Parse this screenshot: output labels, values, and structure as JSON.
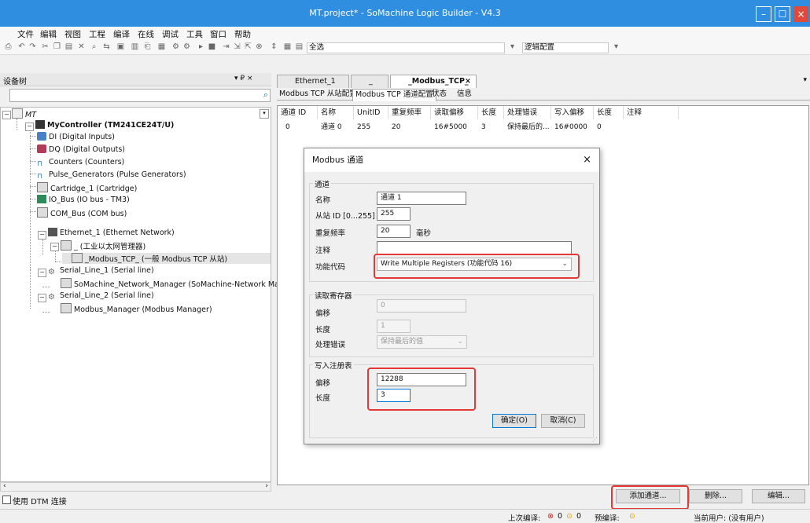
{
  "window": {
    "title": "MT.project* - SoMachine Logic Builder - V4.3"
  },
  "menu": [
    "文件",
    "编辑",
    "视图",
    "工程",
    "编译",
    "在线",
    "调试",
    "工具",
    "窗口",
    "帮助"
  ],
  "toolbar": {
    "select_all": "全选",
    "config_combo": "逻辑配置"
  },
  "device_tree": {
    "title": "设备树",
    "header_icons": "▾ ₽ ×",
    "nodes": [
      {
        "label": "MT",
        "level": 0
      },
      {
        "label": "MyController (TM241CE24T/U)",
        "level": 1
      },
      {
        "label": "DI (Digital Inputs)",
        "level": 2
      },
      {
        "label": "DQ (Digital Outputs)",
        "level": 2
      },
      {
        "label": "Counters (Counters)",
        "level": 2
      },
      {
        "label": "Pulse_Generators (Pulse Generators)",
        "level": 2
      },
      {
        "label": "Cartridge_1 (Cartridge)",
        "level": 2
      },
      {
        "label": "IO_Bus (IO bus - TM3)",
        "level": 2
      },
      {
        "label": "COM_Bus (COM bus)",
        "level": 2
      },
      {
        "label": "Ethernet_1 (Ethernet Network)",
        "level": 2
      },
      {
        "label": "_ (工业以太网管理器)",
        "level": 3
      },
      {
        "label": "_Modbus_TCP_ (一般 Modbus TCP 从站)",
        "level": 4
      },
      {
        "label": "Serial_Line_1 (Serial line)",
        "level": 2
      },
      {
        "label": "SoMachine_Network_Manager (SoMachine-Network Manager)",
        "level": 3
      },
      {
        "label": "Serial_Line_2 (Serial line)",
        "level": 2
      },
      {
        "label": "Modbus_Manager (Modbus Manager)",
        "level": 3
      }
    ],
    "dtm_checkbox": "使用 DTM 连接"
  },
  "doc_tabs": [
    "Ethernet_1",
    "_",
    "_Modbus_TCP_"
  ],
  "sub_tabs": [
    "Modbus TCP 从站配置",
    "Modbus TCP 通道配置",
    "状态",
    "信息"
  ],
  "channel_grid": {
    "headers": [
      "通道 ID",
      "名称",
      "UnitID",
      "重复频率",
      "读取偏移",
      "长度",
      "处理错误",
      "写入偏移",
      "长度",
      "注释"
    ],
    "rows": [
      [
        "0",
        "通道 0",
        "255",
        "20",
        "16#5000",
        "3",
        "保持最后的...",
        "16#0000",
        "0",
        ""
      ]
    ]
  },
  "bottom_buttons": {
    "add": "添加通道...",
    "delete": "删除...",
    "edit": "编辑..."
  },
  "dialog": {
    "title": "Modbus 通道",
    "close": "×",
    "channel_group": "通道",
    "name_label": "名称",
    "name_value": "通道 1",
    "slave_label": "从站 ID [0...255]",
    "slave_value": "255",
    "repeat_label": "重复频率",
    "repeat_value": "20",
    "repeat_unit": "毫秒",
    "comment_label": "注释",
    "comment_value": "",
    "func_label": "功能代码",
    "func_value": "Write Multiple Registers (功能代码 16)",
    "read_group": "读取寄存器",
    "read_offset_label": "偏移",
    "read_offset_value": "0",
    "read_length_label": "长度",
    "read_length_value": "1",
    "read_error_label": "处理错误",
    "read_error_value": "保持最后的值",
    "write_group": "写入注册表",
    "write_offset_label": "偏移",
    "write_offset_value": "12288",
    "write_length_label": "长度",
    "write_length_value": "3",
    "ok": "确定(O)",
    "cancel": "取消(C)"
  },
  "status": {
    "last_compile_label": "上次编译:",
    "errors": "0",
    "warnings": "0",
    "precompile_label": "预编译:",
    "current_user": "当前用户: (没有用户)"
  },
  "colors": {
    "titlebar": "#2f8ee0",
    "highlight": "#e53935",
    "ok_border": "#0078d7"
  }
}
